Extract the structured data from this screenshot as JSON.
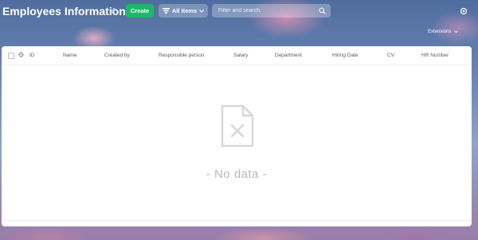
{
  "header": {
    "title": "Employees Information",
    "create_label": "Create",
    "filter_label": "All items",
    "search_placeholder": "Filter and search"
  },
  "toolbar": {
    "extensions_label": "Extensions"
  },
  "table": {
    "columns": [
      "ID",
      "Name",
      "Created by",
      "Responsible person",
      "Salary",
      "Department",
      "Hiring Date",
      "CV",
      "HR Number"
    ],
    "rows": [],
    "empty_text": "- No data -"
  },
  "colors": {
    "create_button": "#1fb76a",
    "panel_background": "#ffffff",
    "header_text": "#525c69",
    "empty_text": "#b4b9be"
  },
  "icons": {
    "title_edit": "pencil-icon",
    "filter": "filter-icon",
    "filter_dropdown": "chevron-down-icon",
    "search": "search-icon",
    "settings": "settings-icon",
    "columns": "gear-icon",
    "empty": "document-x-icon"
  }
}
